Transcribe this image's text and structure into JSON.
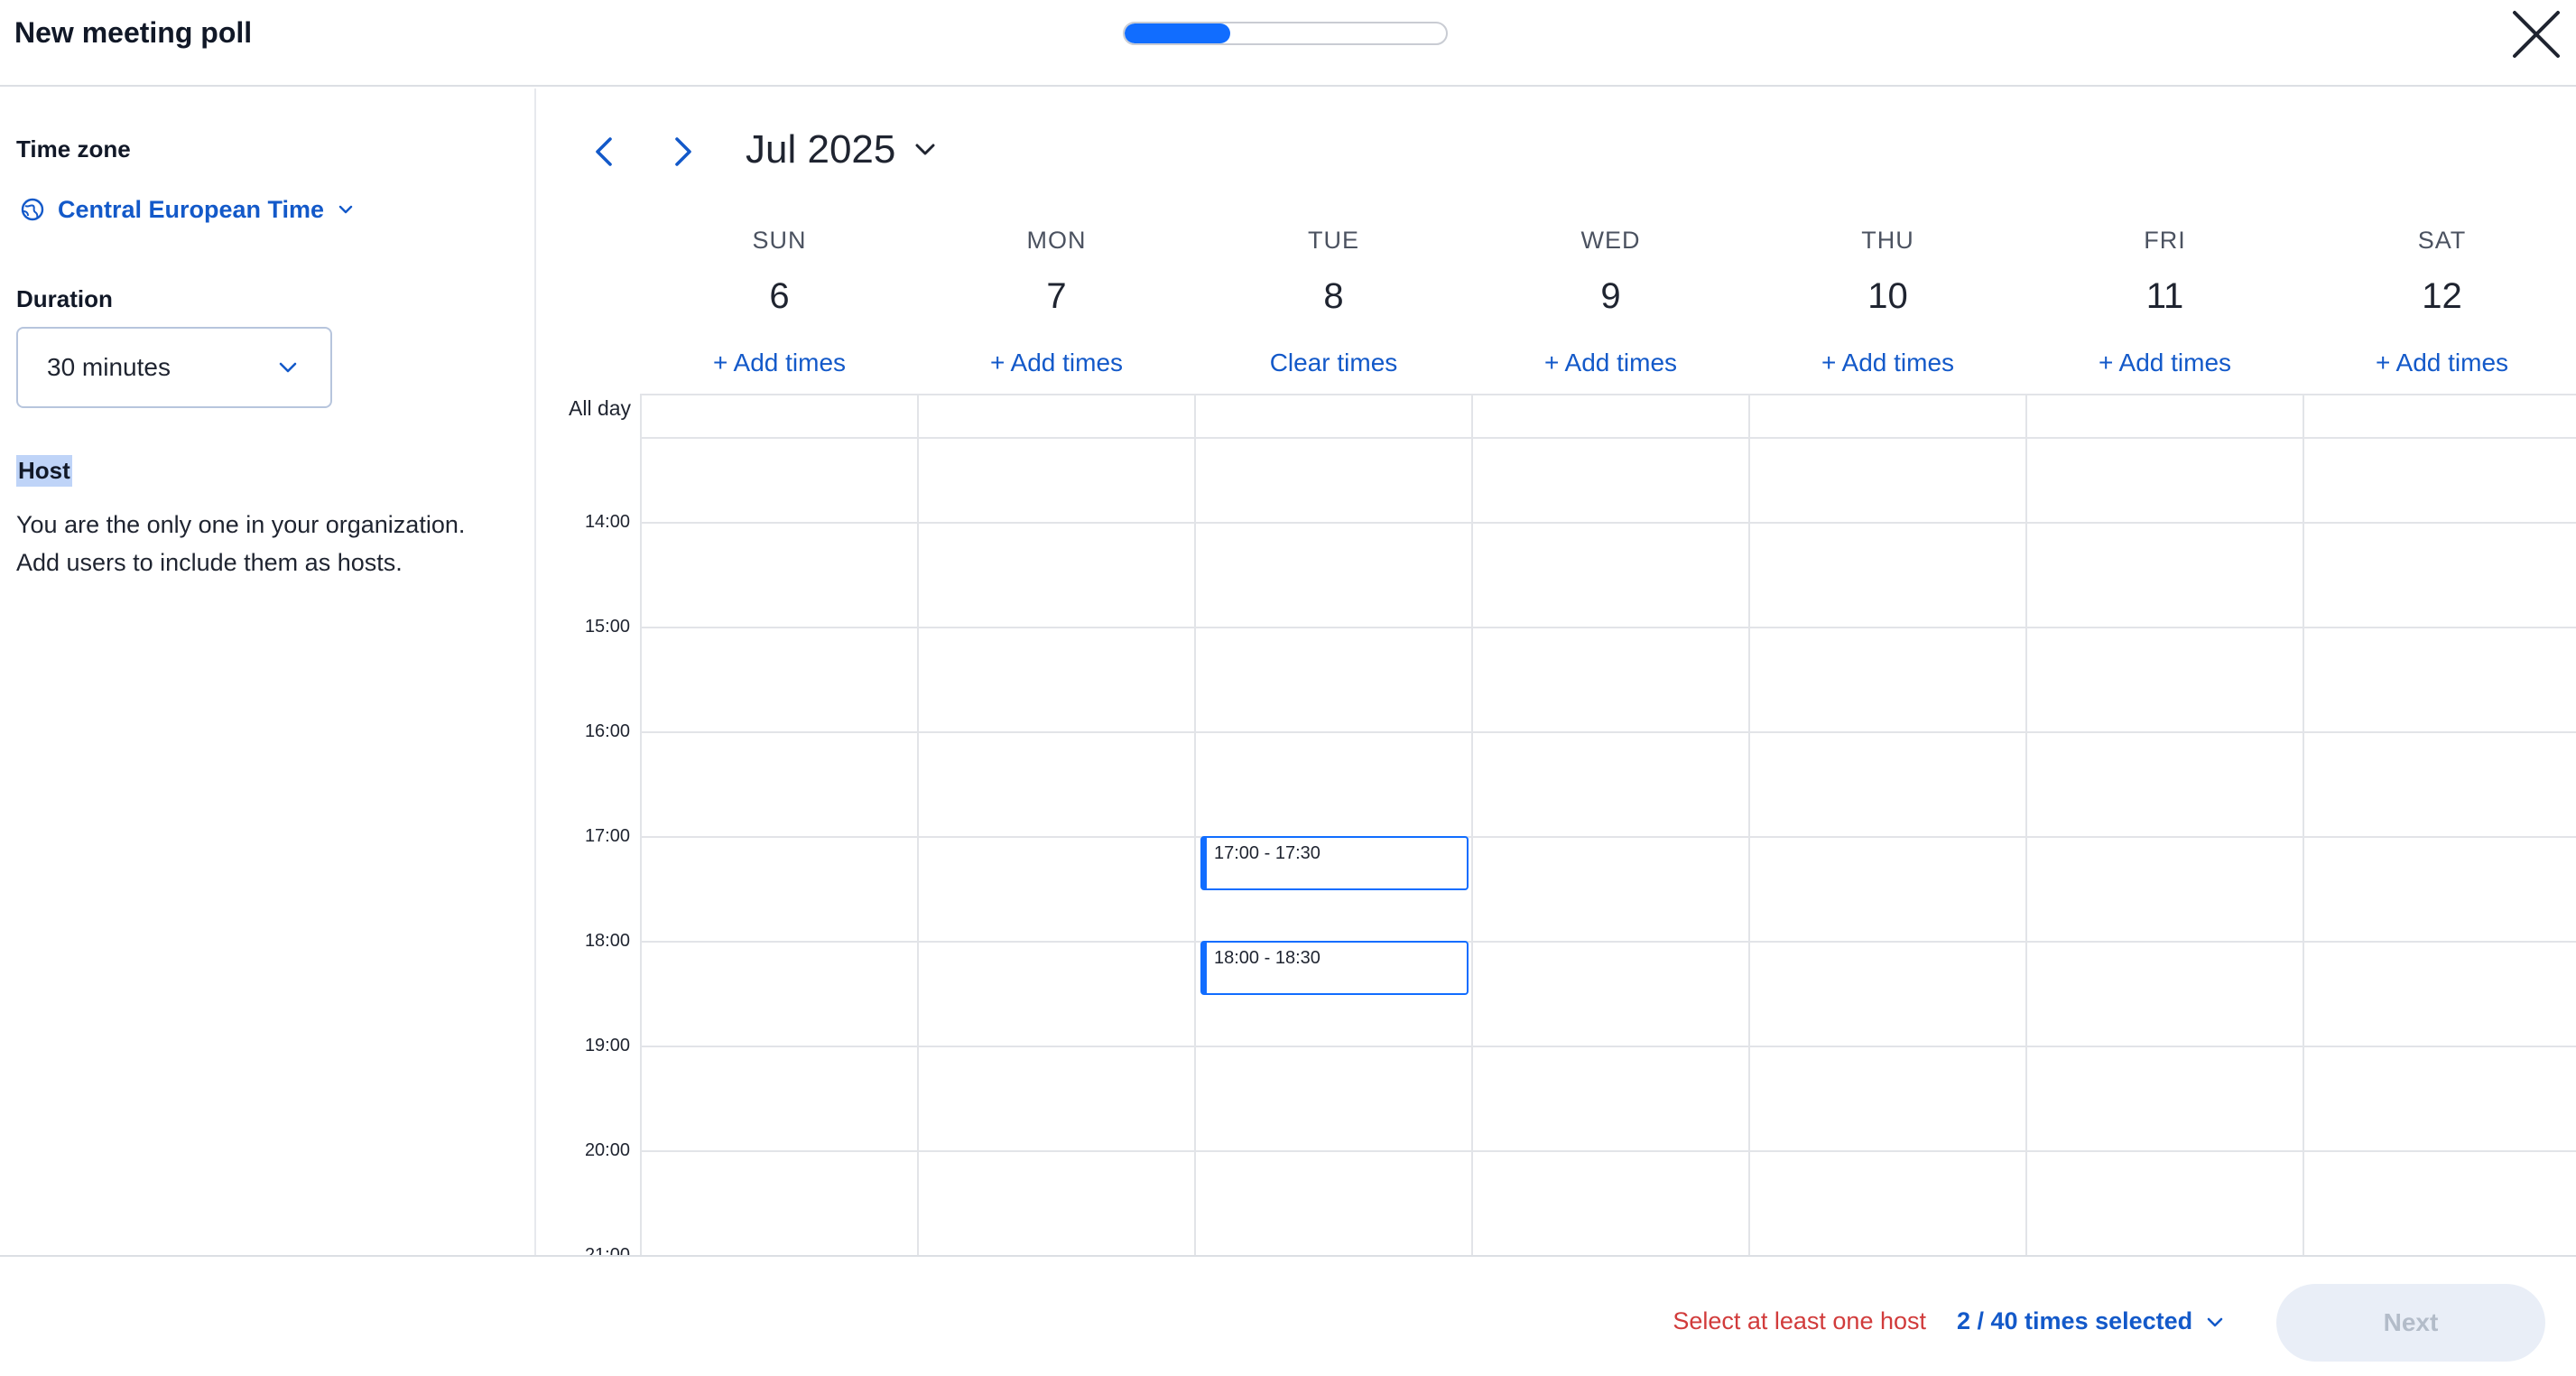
{
  "header": {
    "title": "New meeting poll",
    "progress_percent": 33
  },
  "sidebar": {
    "timezone_label": "Time zone",
    "timezone_value": "Central European Time",
    "duration_label": "Duration",
    "duration_value": "30 minutes",
    "host_label": "Host",
    "host_text_line1": "You are the only one in your organization.",
    "host_text_line2": "Add users to include them as hosts."
  },
  "calendar": {
    "month_label": "Jul 2025",
    "allday_label": "All day",
    "days": [
      {
        "name": "SUN",
        "number": "6",
        "action": "+ Add times"
      },
      {
        "name": "MON",
        "number": "7",
        "action": "+ Add times"
      },
      {
        "name": "TUE",
        "number": "8",
        "action": "Clear times"
      },
      {
        "name": "WED",
        "number": "9",
        "action": "+ Add times"
      },
      {
        "name": "THU",
        "number": "10",
        "action": "+ Add times"
      },
      {
        "name": "FRI",
        "number": "11",
        "action": "+ Add times"
      },
      {
        "name": "SAT",
        "number": "12",
        "action": "+ Add times"
      }
    ],
    "hours": [
      "14:00",
      "15:00",
      "16:00",
      "17:00",
      "18:00",
      "19:00",
      "20:00",
      "21:00"
    ],
    "selected_slots": [
      {
        "day": "TUE",
        "label": "17:00 - 17:30"
      },
      {
        "day": "TUE",
        "label": "18:00 - 18:30"
      }
    ]
  },
  "footer": {
    "warning": "Select at least one host",
    "times_selected": "2 / 40 times selected",
    "next_label": "Next"
  },
  "colors": {
    "accent": "#116dff",
    "link": "#1359c9",
    "warning": "#d13b3b",
    "grid_line": "#e2e4e8",
    "disabled_button_bg": "#e9eef7"
  },
  "icons": {
    "close": "close-icon",
    "prev": "chevron-left-icon",
    "next": "chevron-right-icon",
    "month_dropdown": "chevron-down-icon",
    "timezone": "globe-icon"
  }
}
